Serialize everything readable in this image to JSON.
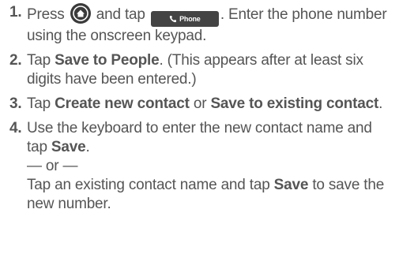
{
  "steps": [
    {
      "num": "1.",
      "t1": "Press",
      "t2": "and tap",
      "t3": ". Enter the phone number using the onscreen keypad."
    },
    {
      "num": "2.",
      "t1": "Tap",
      "b1": "Save to People",
      "t2": ". (This appears after at least six digits have been entered.)"
    },
    {
      "num": "3.",
      "t1": "Tap",
      "b1": "Create new contact",
      "t2": "or",
      "b2": "Save to existing contact",
      "t3": "."
    },
    {
      "num": "4.",
      "t1": "Use the keyboard to enter the new contact name and tap",
      "b1": "Save",
      "t2": ".",
      "or": "— or —",
      "t3": "Tap an existing contact name and tap",
      "b2": "Save",
      "t4": "to save the new number."
    }
  ],
  "icons": {
    "home": "home-icon",
    "phone_button_label": "Phone"
  },
  "colors": {
    "text": "#555555",
    "icon_bg": "#3a3a3a",
    "button_bg": "#444444"
  }
}
